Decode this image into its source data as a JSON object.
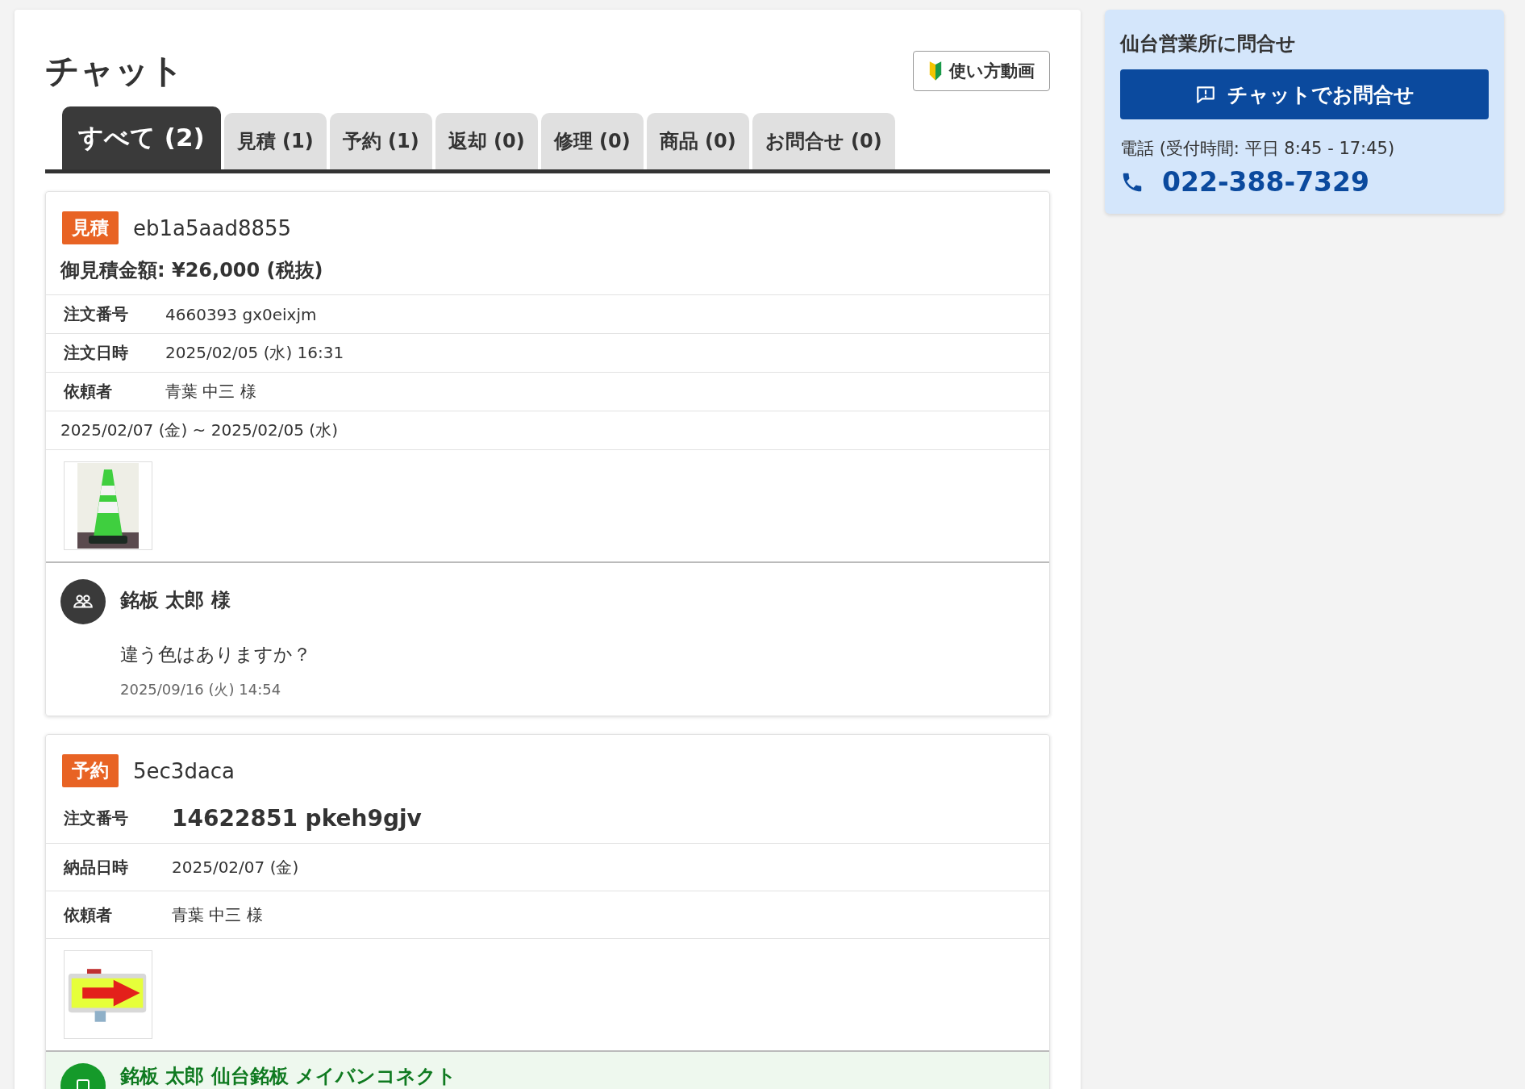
{
  "page": {
    "title": "チャット",
    "help_button": "使い方動画"
  },
  "tabs": [
    {
      "label": "すべて (2)",
      "selected": true
    },
    {
      "label": "見積 (1)",
      "selected": false
    },
    {
      "label": "予約 (1)",
      "selected": false
    },
    {
      "label": "返却 (0)",
      "selected": false
    },
    {
      "label": "修理 (0)",
      "selected": false
    },
    {
      "label": "商品 (0)",
      "selected": false
    },
    {
      "label": "お問合せ (0)",
      "selected": false
    }
  ],
  "threads": [
    {
      "category": "見積",
      "id": "eb1a5aad8855",
      "summary": "御見積金額: ¥26,000 (税抜)",
      "fields": [
        {
          "label": "注文番号",
          "value": "4660393 gx0eixjm",
          "bold": false
        },
        {
          "label": "注文日時",
          "value": "2025/02/05 (水) 16:31",
          "bold": false
        },
        {
          "label": "依頼者",
          "value": "青葉 中三 様",
          "bold": false
        }
      ],
      "period": "2025/02/07 (金) ~ 2025/02/05 (水)",
      "message": {
        "kind": "customer",
        "sender": "銘板 太郎 様",
        "text": "違う色はありますか？",
        "time": "2025/09/16 (火) 14:54"
      }
    },
    {
      "category": "予約",
      "id": "5ec3daca",
      "fields": [
        {
          "label": "注文番号",
          "value": "14622851 pkeh9gjv",
          "bold": true
        },
        {
          "label": "納品日時",
          "value": "2025/02/07 (金)",
          "bold": false
        },
        {
          "label": "依頼者",
          "value": "青葉 中三  様",
          "bold": false
        }
      ],
      "message": {
        "kind": "staff",
        "sender": "銘板 太郎 仙台銘板 メイバンコネクト"
      }
    }
  ],
  "contact": {
    "title": "仙台営業所に問合せ",
    "chat_button": "チャットでお問合せ",
    "phone_label": "電話 (受付時間: 平日 8:45 - 17:45)",
    "phone": "022-388-7329"
  }
}
